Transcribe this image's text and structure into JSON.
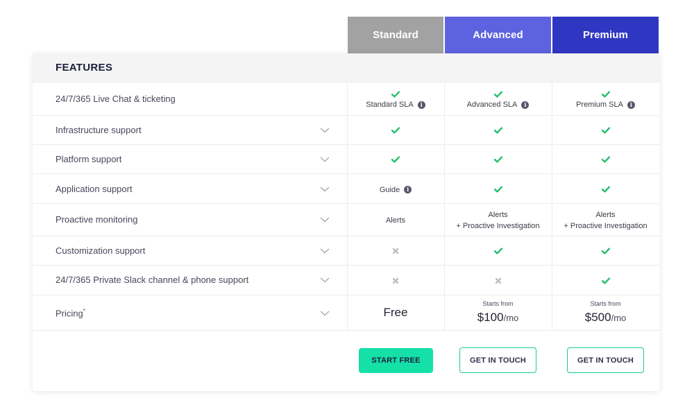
{
  "plans": [
    "Standard",
    "Advanced",
    "Premium"
  ],
  "features_title": "FEATURES",
  "rows": [
    {
      "label": "24/7/365 Live Chat & ticketing",
      "expandable": false
    },
    {
      "label": "Infrastructure support",
      "expandable": true
    },
    {
      "label": "Platform support",
      "expandable": true
    },
    {
      "label": "Application support",
      "expandable": true
    },
    {
      "label": "Proactive monitoring",
      "expandable": true
    },
    {
      "label": "Customization support",
      "expandable": true
    },
    {
      "label": "24/7/365 Private Slack channel & phone support",
      "expandable": true
    },
    {
      "label": "Pricing",
      "label_suffix": "*",
      "expandable": true
    }
  ],
  "cells": {
    "sla": [
      "Standard SLA",
      "Advanced SLA",
      "Premium SLA"
    ],
    "application_standard": "Guide",
    "monitoring_standard": "Alerts",
    "monitoring_advanced": [
      "Alerts",
      "+ Proactive Investigation"
    ],
    "monitoring_premium": [
      "Alerts",
      "+ Proactive Investigation"
    ]
  },
  "pricing": {
    "standard": "Free",
    "starts_from": "Starts from",
    "advanced_amount": "$100",
    "premium_amount": "$500",
    "per": "/mo"
  },
  "buttons": {
    "start_free": "START FREE",
    "get_in_touch": "GET IN TOUCH"
  },
  "colors": {
    "standard": "#a2a2a2",
    "advanced": "#5d63e0",
    "premium": "#2f37c2",
    "check": "#1fbf6a",
    "cross": "#bdbdbd",
    "cta": "#14e0a8"
  }
}
